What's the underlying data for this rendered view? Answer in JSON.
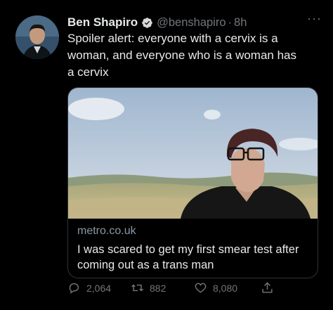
{
  "tweet": {
    "author_name": "Ben Shapiro",
    "handle": "@benshapiro",
    "separator": "·",
    "time": "8h",
    "more": "···",
    "text": "Spoiler alert: everyone with a cervix is a\nwoman, and everyone who is a woman has\na cervix"
  },
  "card": {
    "domain": "metro.co.uk",
    "title": "I was scared to get my first smear test after coming out as a trans man"
  },
  "actions": {
    "replies": "2,064",
    "retweets": "882",
    "likes": "8,080"
  },
  "colors": {
    "background": "#000000",
    "text": "#e7e9ea",
    "muted": "#71767b",
    "verified": "#d9d9d9"
  }
}
